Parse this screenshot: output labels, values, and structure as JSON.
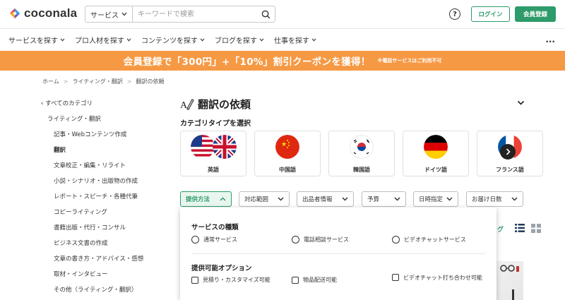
{
  "header": {
    "logo_text": "coconala",
    "search": {
      "category_label": "サービス",
      "placeholder": "キーワードで検索"
    },
    "help_label": "?",
    "login_label": "ログイン",
    "register_label": "会員登録"
  },
  "nav": {
    "items": [
      {
        "label": "サービスを探す"
      },
      {
        "label": "プロ人材を探す"
      },
      {
        "label": "コンテンツを探す"
      },
      {
        "label": "ブログを探す"
      },
      {
        "label": "仕事を探す"
      }
    ],
    "more_label": "..."
  },
  "banner": {
    "text": "会員登録で「300円」+「10%」割引クーポンを獲得！",
    "note": "※電話サービスはご利用不可"
  },
  "breadcrumb": [
    "ホーム",
    "ライティング・翻訳",
    "翻訳の依頼"
  ],
  "sidebar": {
    "back_label": "すべてのカテゴリ",
    "parent": "ライティング・翻訳",
    "items": [
      {
        "label": "記事・Webコンテンツ作成"
      },
      {
        "label": "翻訳",
        "active": true
      },
      {
        "label": "文章校正・編集・リライト"
      },
      {
        "label": "小説・シナリオ・出版物の作成"
      },
      {
        "label": "レポート・スピーチ・各種代筆"
      },
      {
        "label": "コピーライティング"
      },
      {
        "label": "書籍出版・代行・コンサル"
      },
      {
        "label": "ビジネス文書の作成"
      },
      {
        "label": "文章の書き方・アドバイス・感想"
      },
      {
        "label": "取材・インタビュー"
      },
      {
        "label": "その他（ライティング・翻訳）"
      }
    ]
  },
  "main": {
    "title": "翻訳の依頼",
    "category_heading": "カテゴリタイプを選択",
    "categories": [
      {
        "label": "英語"
      },
      {
        "label": "中国語"
      },
      {
        "label": "韓国語"
      },
      {
        "label": "ドイツ語"
      },
      {
        "label": "フランス語"
      }
    ],
    "filters": [
      {
        "label": "提供方法",
        "active": true
      },
      {
        "label": "対応範囲"
      },
      {
        "label": "出品者情報"
      },
      {
        "label": "予算"
      },
      {
        "label": "日時指定"
      },
      {
        "label": "お届け日数"
      }
    ],
    "panel": {
      "service_type_heading": "サービスの種類",
      "service_types": [
        "通常サービス",
        "電話相談サービス",
        "ビデオチャットサービス"
      ],
      "options_heading": "提供可能オプション",
      "options": [
        "見積り・カスタマイズ可能",
        "物品配送可能",
        "ビデオチャット打ち合わせ可能"
      ]
    },
    "sort_fragment": "グ"
  },
  "colors": {
    "brand_green": "#2e9b6a",
    "banner_orange": "#f69944"
  }
}
